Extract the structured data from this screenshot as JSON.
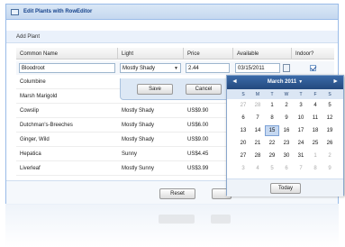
{
  "window": {
    "title": "Edit Plants with RowEditor"
  },
  "toolbar": {
    "add_label": "Add Plant"
  },
  "columns": {
    "name": "Common Name",
    "light": "Light",
    "price": "Price",
    "available": "Available",
    "indoor": "Indoor?"
  },
  "editor": {
    "name": "Bloodroot",
    "light": "Mostly Shady",
    "price": "2.44",
    "available": "03/15/2011",
    "indoor": true,
    "save_label": "Save",
    "cancel_label": "Cancel"
  },
  "rows": [
    {
      "name": "Columbine",
      "light": "",
      "price": ""
    },
    {
      "name": "Marsh Marigold",
      "light": "",
      "price": ""
    },
    {
      "name": "Cowslip",
      "light": "Mostly Shady",
      "price": "US$9.90"
    },
    {
      "name": "Dutchman's-Breeches",
      "light": "Mostly Shady",
      "price": "US$6.00"
    },
    {
      "name": "Ginger, Wild",
      "light": "Mostly Shady",
      "price": "US$9.00"
    },
    {
      "name": "Hepatica",
      "light": "Sunny",
      "price": "US$4.45"
    },
    {
      "name": "Liverleaf",
      "light": "Mostly Sunny",
      "price": "US$3.99"
    }
  ],
  "bottombar": {
    "reset_label": "Reset"
  },
  "datepicker": {
    "month_label": "March 2011",
    "day_headers": [
      "S",
      "M",
      "T",
      "W",
      "T",
      "F",
      "S"
    ],
    "weeks": [
      [
        {
          "d": "27",
          "o": true
        },
        {
          "d": "28",
          "o": true
        },
        {
          "d": "1"
        },
        {
          "d": "2"
        },
        {
          "d": "3"
        },
        {
          "d": "4"
        },
        {
          "d": "5"
        }
      ],
      [
        {
          "d": "6"
        },
        {
          "d": "7"
        },
        {
          "d": "8"
        },
        {
          "d": "9"
        },
        {
          "d": "10"
        },
        {
          "d": "11"
        },
        {
          "d": "12"
        }
      ],
      [
        {
          "d": "13"
        },
        {
          "d": "14"
        },
        {
          "d": "15",
          "s": true
        },
        {
          "d": "16"
        },
        {
          "d": "17"
        },
        {
          "d": "18"
        },
        {
          "d": "19"
        }
      ],
      [
        {
          "d": "20"
        },
        {
          "d": "21"
        },
        {
          "d": "22"
        },
        {
          "d": "23"
        },
        {
          "d": "24"
        },
        {
          "d": "25"
        },
        {
          "d": "26"
        }
      ],
      [
        {
          "d": "27"
        },
        {
          "d": "28"
        },
        {
          "d": "29"
        },
        {
          "d": "30"
        },
        {
          "d": "31"
        },
        {
          "d": "1",
          "o": true
        },
        {
          "d": "2",
          "o": true
        }
      ],
      [
        {
          "d": "3",
          "o": true
        },
        {
          "d": "4",
          "o": true
        },
        {
          "d": "5",
          "o": true
        },
        {
          "d": "6",
          "o": true
        },
        {
          "d": "7",
          "o": true
        },
        {
          "d": "8",
          "o": true
        },
        {
          "d": "9",
          "o": true
        }
      ]
    ],
    "today_label": "Today"
  },
  "colors": {
    "accent": "#23497e",
    "header_blue": "#15428b",
    "selected_day": "#c5d8f1"
  }
}
